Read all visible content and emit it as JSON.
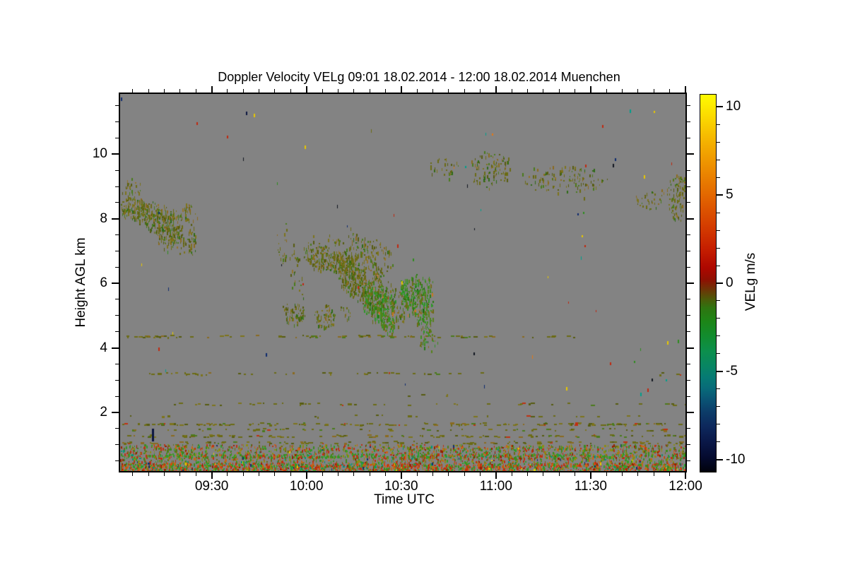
{
  "window": {
    "background": "#ffffff"
  },
  "chart_data": {
    "type": "heatmap",
    "title": "Doppler Velocity VELg   09:01 18.02.2014 - 12:00 18.02.2014 Muenchen",
    "instrument_variable": "VELg",
    "site": "Muenchen",
    "date": "18.02.2014",
    "time_start_utc": "09:01",
    "time_end_utc": "12:00",
    "xlabel": "Time UTC",
    "ylabel": "Height AGL km",
    "plot_bg_color": "#838383",
    "frame_color": "#000000",
    "x_range_hours": [
      9.0167,
      12.0
    ],
    "y_range_km": [
      0.18,
      11.87
    ],
    "x_major_ticks": [
      {
        "hour": 9.5,
        "label": "09:30"
      },
      {
        "hour": 10.0,
        "label": "10:00"
      },
      {
        "hour": 10.5,
        "label": "10:30"
      },
      {
        "hour": 11.0,
        "label": "11:00"
      },
      {
        "hour": 11.5,
        "label": "11:30"
      },
      {
        "hour": 12.0,
        "label": "12:00"
      }
    ],
    "x_minor_step_hours": 0.0833333,
    "y_major_ticks": [
      {
        "km": 2,
        "label": "2"
      },
      {
        "km": 4,
        "label": "4"
      },
      {
        "km": 6,
        "label": "6"
      },
      {
        "km": 8,
        "label": "8"
      },
      {
        "km": 10,
        "label": "10"
      }
    ],
    "y_minor_step_km": 0.5,
    "colorbar": {
      "label": "VELg m/s",
      "units": "m/s",
      "range": [
        -10.7,
        10.7
      ],
      "major_ticks": [
        {
          "value": 10,
          "label": "10"
        },
        {
          "value": 5,
          "label": "5"
        },
        {
          "value": 0,
          "label": "0"
        },
        {
          "value": -5,
          "label": "-5"
        },
        {
          "value": -10,
          "label": "-10"
        }
      ],
      "minor_step": 1,
      "gradient_stops": [
        [
          0,
          "#fffb00"
        ],
        [
          5,
          "#fcdf00"
        ],
        [
          12,
          "#f5b500"
        ],
        [
          20,
          "#ec8a00"
        ],
        [
          28,
          "#e16000"
        ],
        [
          35,
          "#d43c00"
        ],
        [
          41,
          "#c51e00"
        ],
        [
          46,
          "#ad0700"
        ],
        [
          49,
          "#8f0f02"
        ],
        [
          51.5,
          "#6f3206"
        ],
        [
          54,
          "#4f5708"
        ],
        [
          56.5,
          "#2f7410"
        ],
        [
          60,
          "#1d8517"
        ],
        [
          64,
          "#128c2e"
        ],
        [
          68,
          "#0c8f4c"
        ],
        [
          72,
          "#088563"
        ],
        [
          75,
          "#067a74"
        ],
        [
          78,
          "#086a79"
        ],
        [
          81,
          "#0a5374"
        ],
        [
          84,
          "#0c3d69"
        ],
        [
          88,
          "#0d285c"
        ],
        [
          92,
          "#0a1848"
        ],
        [
          96,
          "#050b30"
        ],
        [
          100,
          "#01020c"
        ]
      ]
    },
    "palettes": {
      "cloud": [
        [
          "#6b6b14",
          30
        ],
        [
          "#7d741c",
          18
        ],
        [
          "#565c10",
          15
        ],
        [
          "#4a7a1c",
          15
        ],
        [
          "#2e6a16",
          8
        ],
        [
          "#8a6a20",
          10
        ],
        [
          "#93742a",
          4
        ]
      ],
      "bright": [
        [
          "#3f8c1e",
          25
        ],
        [
          "#2e9628",
          25
        ],
        [
          "#56821c",
          15
        ],
        [
          "#6b6b14",
          15
        ],
        [
          "#2a7a14",
          10
        ],
        [
          "#8a6a20",
          5
        ],
        [
          "#c87820",
          2
        ],
        [
          "#1e6410",
          3
        ]
      ],
      "line": [
        [
          "#6b6b14",
          45
        ],
        [
          "#7d741c",
          20
        ],
        [
          "#565c10",
          15
        ],
        [
          "#8a6a20",
          8
        ],
        [
          "#4a7a1c",
          7
        ],
        [
          "#c03010",
          5
        ]
      ],
      "bl": [
        [
          "#8c8c14",
          20
        ],
        [
          "#c03010",
          15
        ],
        [
          "#c86418",
          12
        ],
        [
          "#3c8c1e",
          20
        ],
        [
          "#6b6b14",
          15
        ],
        [
          "#962000",
          6
        ],
        [
          "#2ea028",
          8
        ],
        [
          "#00967d",
          2
        ],
        [
          "#e0cc00",
          1
        ],
        [
          "#12306c",
          1
        ]
      ],
      "blGreenRed": [
        [
          "#2ea028",
          30
        ],
        [
          "#3c8c1e",
          20
        ],
        [
          "#c03010",
          18
        ],
        [
          "#c86418",
          10
        ],
        [
          "#8c8c14",
          12
        ],
        [
          "#962000",
          5
        ],
        [
          "#00967d",
          3
        ],
        [
          "#1e8c64",
          2
        ]
      ],
      "blHot": [
        [
          "#c03010",
          22
        ],
        [
          "#c86418",
          14
        ],
        [
          "#d24a10",
          10
        ],
        [
          "#2ea028",
          18
        ],
        [
          "#3c8c1e",
          14
        ],
        [
          "#8c8c14",
          10
        ],
        [
          "#962000",
          6
        ],
        [
          "#00967d",
          3
        ],
        [
          "#e0cc00",
          1
        ],
        [
          "#12306c",
          2
        ]
      ]
    },
    "features": {
      "clouds": [
        {
          "t0": 9.02,
          "t1": 9.13,
          "h0": 8.55,
          "h1": 9.35,
          "density": 0.28,
          "palette": "cloud"
        },
        {
          "t0": 9.02,
          "t1": 9.07,
          "h0": 7.95,
          "h1": 8.75,
          "density": 0.7,
          "palette": "cloud"
        },
        {
          "t0": 9.05,
          "t1": 9.14,
          "h0": 7.95,
          "h1": 8.8,
          "density": 0.6,
          "palette": "cloud"
        },
        {
          "t0": 9.33,
          "t1": 9.43,
          "h0": 7.85,
          "h1": 8.5,
          "density": 0.45,
          "palette": "cloud"
        },
        {
          "t0": 9.84,
          "t1": 9.93,
          "h0": 6.55,
          "h1": 7.95,
          "density": 0.14,
          "palette": "cloud"
        },
        {
          "t0": 9.91,
          "t1": 9.99,
          "h0": 4.7,
          "h1": 7.4,
          "density": 0.12,
          "palette": "cloud"
        },
        {
          "t0": 10.0,
          "t1": 10.2,
          "h0": 7.0,
          "h1": 7.6,
          "density": 0.15,
          "palette": "cloud"
        },
        {
          "t0": 9.86,
          "t1": 10.0,
          "h0": 4.7,
          "h1": 5.45,
          "density": 0.5,
          "palette": "cloud"
        },
        {
          "t0": 10.03,
          "t1": 10.16,
          "h0": 4.55,
          "h1": 5.4,
          "density": 0.45,
          "palette": "cloud"
        },
        {
          "t0": 10.16,
          "t1": 10.25,
          "h0": 4.8,
          "h1": 5.35,
          "density": 0.3,
          "palette": "cloud"
        },
        {
          "t0": 10.58,
          "t1": 10.7,
          "h0": 3.9,
          "h1": 4.6,
          "density": 0.25,
          "palette": "bright"
        },
        {
          "t0": 10.64,
          "t1": 10.83,
          "h0": 9.25,
          "h1": 10.0,
          "density": 0.2,
          "palette": "cloud"
        },
        {
          "t0": 10.85,
          "t1": 11.09,
          "h0": 8.95,
          "h1": 10.15,
          "density": 0.25,
          "palette": "cloud"
        },
        {
          "t0": 11.12,
          "t1": 11.6,
          "h0": 8.8,
          "h1": 9.7,
          "density": 0.22,
          "palette": "cloud"
        },
        {
          "t0": 11.7,
          "t1": 11.92,
          "h0": 8.3,
          "h1": 9.0,
          "density": 0.15,
          "palette": "cloud"
        },
        {
          "t0": 11.9,
          "t1": 12.02,
          "h0": 7.9,
          "h1": 9.5,
          "density": 0.5,
          "palette": "cloud"
        }
      ],
      "virga": [
        {
          "t0": 9.1,
          "t1": 9.34,
          "hb0": 7.9,
          "ht0": 8.68,
          "hb1": 7.1,
          "ht1": 8.3,
          "density": 0.75,
          "palette": "cloud"
        },
        {
          "t0": 9.2,
          "t1": 9.42,
          "hb0": 7.15,
          "ht0": 8.0,
          "hb1": 6.8,
          "ht1": 7.85,
          "density": 0.35,
          "palette": "cloud"
        },
        {
          "t0": 9.98,
          "t1": 10.27,
          "hb0": 6.5,
          "ht0": 7.35,
          "hb1": 6.15,
          "ht1": 6.95,
          "density": 0.7,
          "palette": "cloud"
        },
        {
          "t0": 10.21,
          "t1": 10.46,
          "hb0": 6.85,
          "ht0": 7.8,
          "hb1": 6.35,
          "ht1": 7.15,
          "density": 0.3,
          "palette": "cloud"
        },
        {
          "t0": 10.16,
          "t1": 10.43,
          "hb0": 6.0,
          "ht0": 7.05,
          "hb1": 4.55,
          "ht1": 6.55,
          "density": 0.75,
          "palette": "cloud"
        },
        {
          "t0": 10.3,
          "t1": 10.47,
          "hb0": 5.1,
          "ht0": 6.3,
          "hb1": 4.2,
          "ht1": 5.7,
          "density": 0.8,
          "palette": "bright"
        },
        {
          "t0": 10.44,
          "t1": 10.52,
          "hb0": 4.6,
          "ht0": 6.2,
          "hb1": 4.5,
          "ht1": 6.0,
          "density": 0.25,
          "palette": "cloud"
        },
        {
          "t0": 10.49,
          "t1": 10.67,
          "hb0": 5.45,
          "ht0": 6.25,
          "hb1": 4.05,
          "ht1": 6.35,
          "density": 0.8,
          "palette": "bright"
        }
      ],
      "layer_lines": [
        {
          "h": 4.37,
          "segments": [
            [
              9.04,
              9.36,
              0.5
            ],
            [
              9.36,
              9.93,
              0.14
            ],
            [
              9.93,
              10.6,
              0.4
            ],
            [
              10.6,
              11.0,
              0.35
            ],
            [
              11.0,
              11.47,
              0.12
            ]
          ]
        },
        {
          "h": 3.22,
          "segments": [
            [
              9.15,
              9.55,
              0.3
            ],
            [
              9.55,
              10.08,
              0.1
            ],
            [
              10.08,
              10.52,
              0.25
            ],
            [
              10.52,
              11.05,
              0.12
            ],
            [
              11.85,
              12.0,
              0.2
            ]
          ]
        },
        {
          "h": 2.55,
          "segments": [
            [
              10.5,
              10.75,
              0.12
            ]
          ]
        },
        {
          "h": 2.27,
          "segments": [
            [
              9.2,
              10.62,
              0.15
            ],
            [
              10.68,
              11.55,
              0.12
            ],
            [
              11.62,
              11.8,
              0.1
            ],
            [
              11.87,
              12.0,
              0.3
            ]
          ]
        },
        {
          "h": 1.9,
          "segments": [
            [
              9.05,
              12.0,
              0.06
            ]
          ]
        },
        {
          "h": 1.65,
          "segments": [
            [
              9.02,
              12.0,
              0.42
            ]
          ]
        },
        {
          "h": 1.48,
          "segments": [
            [
              9.02,
              12.0,
              0.16
            ]
          ]
        },
        {
          "h": 1.28,
          "segments": [
            [
              9.02,
              12.0,
              0.3
            ]
          ]
        },
        {
          "h": 1.08,
          "segments": [
            [
              9.02,
              12.0,
              0.28
            ]
          ]
        }
      ],
      "surface_bands": [
        {
          "h0": 0.83,
          "h1": 1.02,
          "density": 0.5,
          "palette": "bl"
        },
        {
          "h0": 0.72,
          "h1": 0.83,
          "density": 0.35,
          "palette": "bl"
        },
        {
          "h0": 0.62,
          "h1": 0.72,
          "density": 1.0,
          "palette": "blGreenRed"
        },
        {
          "h0": 0.45,
          "h1": 0.62,
          "density": 0.38,
          "palette": "bl"
        },
        {
          "h0": 0.18,
          "h1": 0.45,
          "density": 1.05,
          "palette": "blHot"
        }
      ],
      "random_specks": {
        "count": 55,
        "t_range": [
          9.05,
          11.97
        ],
        "h_range": [
          2.5,
          11.7
        ],
        "colors": [
          [
            "#c02810",
            20
          ],
          [
            "#e8c800",
            15
          ],
          [
            "#00a08c",
            14
          ],
          [
            "#0e2a6e",
            12
          ],
          [
            "#10141e",
            8
          ],
          [
            "#e07818",
            12
          ],
          [
            "#2e8c1e",
            9
          ],
          [
            "#6b6b14",
            10
          ]
        ]
      },
      "notable_specks": [
        {
          "t": 9.02,
          "h": 11.75,
          "color": "#0e2a6e",
          "w": 2,
          "hp": 5
        },
        {
          "t": 9.42,
          "h": 11.0,
          "color": "#c02810",
          "w": 2,
          "hp": 4
        },
        {
          "t": 9.68,
          "h": 11.32,
          "color": "#0a1440",
          "w": 2,
          "hp": 5
        },
        {
          "t": 9.72,
          "h": 11.25,
          "color": "#e8c800",
          "w": 2,
          "hp": 5
        },
        {
          "t": 9.99,
          "h": 10.28,
          "color": "#e8c800",
          "w": 2,
          "hp": 5
        },
        {
          "t": 10.5,
          "h": 6.07,
          "color": "#e8c800",
          "w": 2,
          "hp": 5
        },
        {
          "t": 10.27,
          "h": 5.92,
          "color": "#c02810",
          "w": 2,
          "hp": 4
        },
        {
          "t": 9.185,
          "h": 1.5,
          "color": "#0a1440",
          "w": 3,
          "hp": 18
        },
        {
          "t": 10.88,
          "h": 3.85,
          "color": "#10141e",
          "w": 2,
          "hp": 4
        },
        {
          "t": 11.82,
          "h": 3.05,
          "color": "#10141e",
          "w": 2,
          "hp": 4
        },
        {
          "t": 11.37,
          "h": 2.78,
          "color": "#e8c800",
          "w": 2,
          "hp": 5
        },
        {
          "t": 11.6,
          "h": 3.55,
          "color": "#c02810",
          "w": 2,
          "hp": 4
        },
        {
          "t": 11.47,
          "h": 9.68,
          "color": "#c02810",
          "w": 2,
          "hp": 4
        },
        {
          "t": 11.78,
          "h": 9.35,
          "color": "#e8c800",
          "w": 2,
          "hp": 5
        }
      ]
    },
    "render_seed": 20140218
  }
}
